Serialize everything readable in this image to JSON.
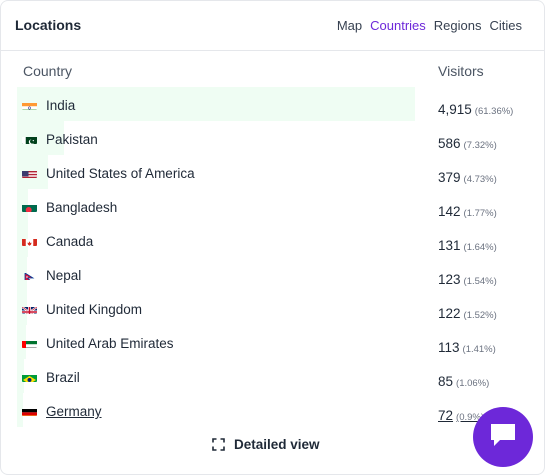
{
  "header": {
    "title": "Locations",
    "tabs": [
      {
        "label": "Map",
        "active": false
      },
      {
        "label": "Countries",
        "active": true
      },
      {
        "label": "Regions",
        "active": false
      },
      {
        "label": "Cities",
        "active": false
      }
    ]
  },
  "table": {
    "col_country": "Country",
    "col_visitors": "Visitors",
    "rows": [
      {
        "flag": "india-flag-icon",
        "name": "India",
        "count": "4,915",
        "pct": "(61.36%)",
        "share": 61.36
      },
      {
        "flag": "pakistan-flag-icon",
        "name": "Pakistan",
        "count": "586",
        "pct": "(7.32%)",
        "share": 7.32
      },
      {
        "flag": "usa-flag-icon",
        "name": "United States of America",
        "count": "379",
        "pct": "(4.73%)",
        "share": 4.73
      },
      {
        "flag": "bangladesh-flag-icon",
        "name": "Bangladesh",
        "count": "142",
        "pct": "(1.77%)",
        "share": 1.77
      },
      {
        "flag": "canada-flag-icon",
        "name": "Canada",
        "count": "131",
        "pct": "(1.64%)",
        "share": 1.64
      },
      {
        "flag": "nepal-flag-icon",
        "name": "Nepal",
        "count": "123",
        "pct": "(1.54%)",
        "share": 1.54
      },
      {
        "flag": "uk-flag-icon",
        "name": "United Kingdom",
        "count": "122",
        "pct": "(1.52%)",
        "share": 1.52
      },
      {
        "flag": "uae-flag-icon",
        "name": "United Arab Emirates",
        "count": "113",
        "pct": "(1.41%)",
        "share": 1.41
      },
      {
        "flag": "brazil-flag-icon",
        "name": "Brazil",
        "count": "85",
        "pct": "(1.06%)",
        "share": 1.06
      },
      {
        "flag": "germany-flag-icon",
        "name": "Germany",
        "count": "72",
        "pct": "(0.9%)",
        "share": 0.9
      }
    ]
  },
  "footer": {
    "detailed_label": "Detailed view"
  },
  "colors": {
    "accent": "#6d28d9",
    "bar": "#effdf3"
  }
}
